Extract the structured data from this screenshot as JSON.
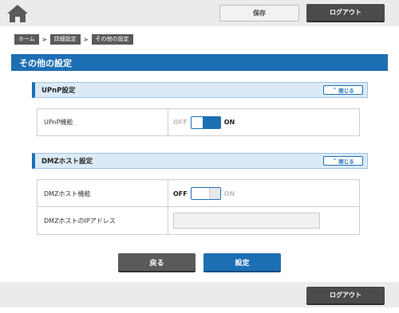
{
  "header": {
    "home_icon": "home-icon",
    "save_label": "保存",
    "logout_label": "ログアウト"
  },
  "breadcrumb": {
    "items": [
      "ホーム",
      "詳細設定",
      "その他の設定"
    ],
    "separator": ">"
  },
  "page": {
    "title": "その他の設定"
  },
  "sections": {
    "upnp": {
      "title": "UPnP設定",
      "collapse_label": "閉じる",
      "rows": {
        "function_label": "UPnP機能",
        "off_label": "OFF",
        "on_label": "ON",
        "state": "ON"
      }
    },
    "dmz": {
      "title": "DMZホスト設定",
      "collapse_label": "閉じる",
      "rows": {
        "function_label": "DMZホスト機能",
        "off_label": "OFF",
        "on_label": "ON",
        "state": "OFF",
        "ip_label": "DMZホストのIPアドレス",
        "ip_value": ""
      }
    }
  },
  "actions": {
    "back_label": "戻る",
    "apply_label": "設定"
  },
  "footer": {
    "logout_label": "ログアウト"
  },
  "colors": {
    "accent": "#1d6fb3",
    "dark_button": "#4b4b4b",
    "header_bg": "#ebebeb"
  }
}
